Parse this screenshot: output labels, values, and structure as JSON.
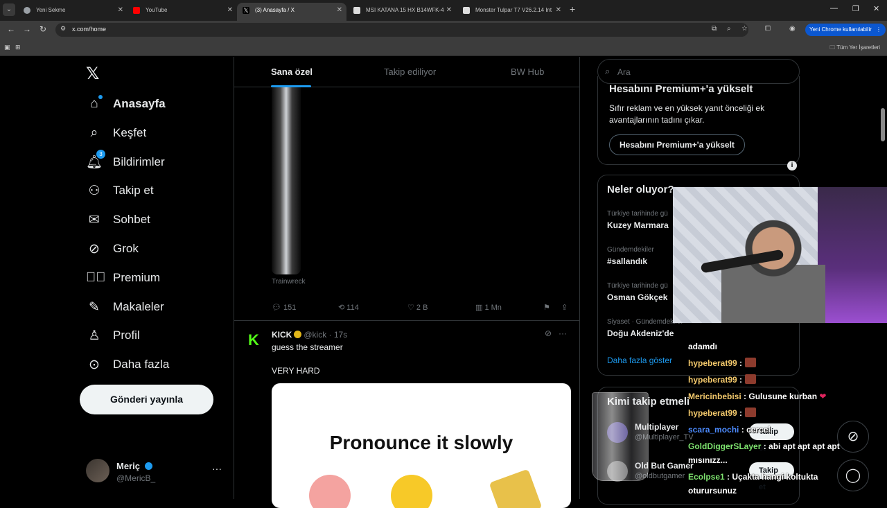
{
  "browser": {
    "tabs": [
      {
        "title": "Yeni Sekme",
        "favicon": "chrome-icon"
      },
      {
        "title": "YouTube",
        "favicon": "youtube-icon"
      },
      {
        "title": "(3) Anasayfa / X",
        "favicon": "x-icon"
      },
      {
        "title": "MSI KATANA 15 HX B14WFK-4",
        "favicon": "store-icon"
      },
      {
        "title": "Monster Tulpar T7 V26.2.14 Int",
        "favicon": "store-icon"
      }
    ],
    "active_tab": 2,
    "url": "x.com/home",
    "update_label": "Yeni Chrome kullanılabilir",
    "bookmarks_folder": "Tüm Yer İşaretleri",
    "accent": "#0b57d0"
  },
  "x": {
    "brand_color": "#1d9bf0",
    "nav": [
      {
        "label": "Anasayfa",
        "icon": "home-icon",
        "active": true
      },
      {
        "label": "Keşfet",
        "icon": "search-icon"
      },
      {
        "label": "Bildirimler",
        "icon": "bell-icon",
        "badge": "3"
      },
      {
        "label": "Takip et",
        "icon": "person-plus-icon"
      },
      {
        "label": "Sohbet",
        "icon": "mail-icon"
      },
      {
        "label": "Grok",
        "icon": "grok-icon"
      },
      {
        "label": "Premium",
        "icon": "verified-icon"
      },
      {
        "label": "Makaleler",
        "icon": "articles-icon"
      },
      {
        "label": "Profil",
        "icon": "person-icon"
      },
      {
        "label": "Daha fazla",
        "icon": "more-circle-icon"
      }
    ],
    "post_button": "Gönderi yayınla",
    "me": {
      "name": "Meriç",
      "handle": "@MericB_"
    },
    "feed_tabs": [
      "Sana özel",
      "Takip ediliyor",
      "BW Hub"
    ],
    "prev_post": {
      "caption": "Trainwreck",
      "replies": "151",
      "reposts": "114",
      "likes": "2 B",
      "views": "1 Mn"
    },
    "post": {
      "name": "KICK",
      "handle": "@kick",
      "time": "17s",
      "text1": "guess the streamer",
      "text2": "VERY HARD",
      "card_title": "Pronounce it slowly"
    },
    "search_placeholder": "Ara",
    "premium": {
      "title": "Hesabını Premium+'a yükselt",
      "desc": "Sıfır reklam ve en yüksek yanıt önceliği ek avantajlarının tadını çıkar.",
      "button": "Hesabını Premium+'a yükselt"
    },
    "trends_title": "Neler oluyor?",
    "trends": [
      {
        "ctx": "Türkiye tarihinde gü",
        "name": "Kuzey Marmara"
      },
      {
        "ctx": "Gündemdekiler",
        "name": "#sallandık"
      },
      {
        "ctx": "Türkiye tarihinde gü",
        "name": "Osman Gökçek"
      },
      {
        "ctx": "Siyaset · Gündemdekiler",
        "name": "Doğu Akdeniz'de"
      }
    ],
    "trends_more": "Daha fazla göster",
    "who_to_follow": "Kimi takip etmeli",
    "suggestions": [
      {
        "name": "Multiplayer",
        "handle": "@Multiplayer_TV",
        "button": "Takip et"
      },
      {
        "name": "Old But Gamer",
        "handle": "@oldbutgamer",
        "button": "Takip et"
      }
    ]
  },
  "stream_chat": [
    {
      "user": "",
      "text": "adamdı"
    },
    {
      "user": "hypeberat99",
      "text": ":",
      "emote": true
    },
    {
      "user": "hypeberat99",
      "text": ":",
      "emote": true
    },
    {
      "user": "Mericinbebisi",
      "text": ": Gulusune kurban",
      "heart": "❤"
    },
    {
      "user": "hypeberat99",
      "text": ":",
      "emote": true
    },
    {
      "user": "scara_mochi",
      "text": ": cercel"
    },
    {
      "user": "GoldDiggerSLayer",
      "text": ": abi apt apt apt apt aptal"
    },
    {
      "user": "",
      "text": "mısınızz..."
    },
    {
      "user": "Ecolpse1",
      "text": ": Uçakta hangi koltukta"
    },
    {
      "user": "",
      "text": "oturursunuz"
    }
  ]
}
